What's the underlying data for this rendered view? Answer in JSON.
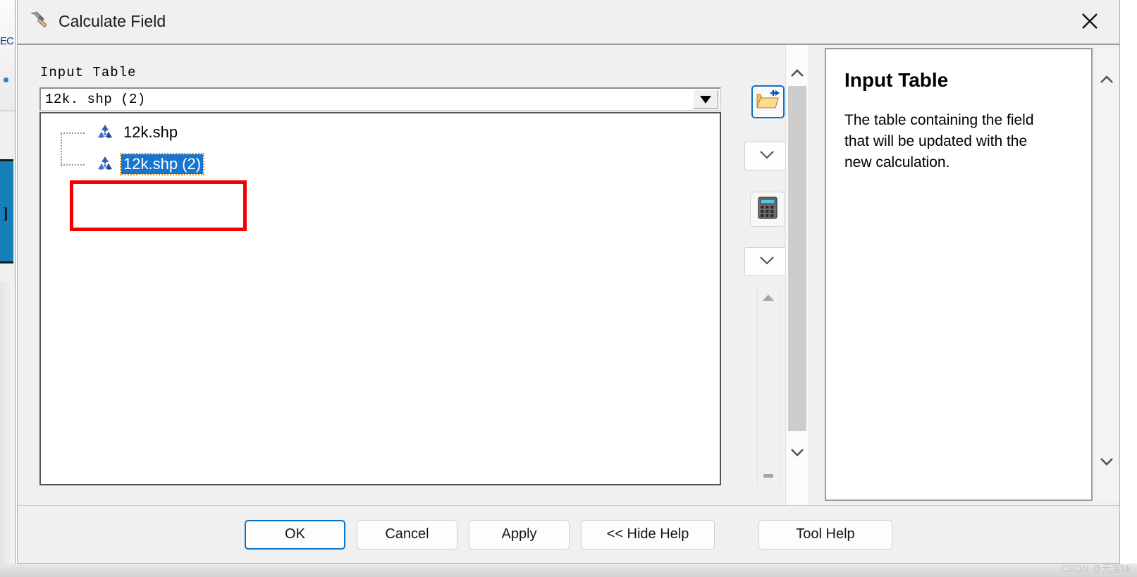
{
  "window": {
    "title": "Calculate Field",
    "title_icon": "hammer-icon",
    "close_icon": "close-icon"
  },
  "parameters": {
    "input_table": {
      "label": "Input Table",
      "value": "12k. shp  (2)",
      "dropdown_arrow_icon": "dropdown-arrow-icon",
      "browse_icon": "folder-open-add-icon",
      "options": [
        {
          "label": "12k.shp",
          "icon": "shapefile-icon",
          "selected": false
        },
        {
          "label": "12k.shp (2)",
          "icon": "shapefile-icon",
          "selected": true
        }
      ]
    },
    "tool_buttons": {
      "chevron_one_icon": "chevron-down-icon",
      "chevron_two_icon": "chevron-down-icon",
      "calculator_icon": "calculator-icon"
    }
  },
  "annotation": {
    "highlight_color": "#f40000"
  },
  "help": {
    "title": "Input Table",
    "body": "The table containing the field that will be updated with the new calculation."
  },
  "footer": {
    "ok": "OK",
    "cancel": "Cancel",
    "apply": "Apply",
    "hide_help": "<< Hide Help",
    "tool_help": "Tool Help"
  },
  "watermark": "CSDN @元宝kk",
  "background": {
    "fragment_text": "EC"
  },
  "colors": {
    "accent": "#0a73c6",
    "selection": "#1874cd",
    "focus_outline": "#e08a14",
    "annotation": "#f40000"
  }
}
